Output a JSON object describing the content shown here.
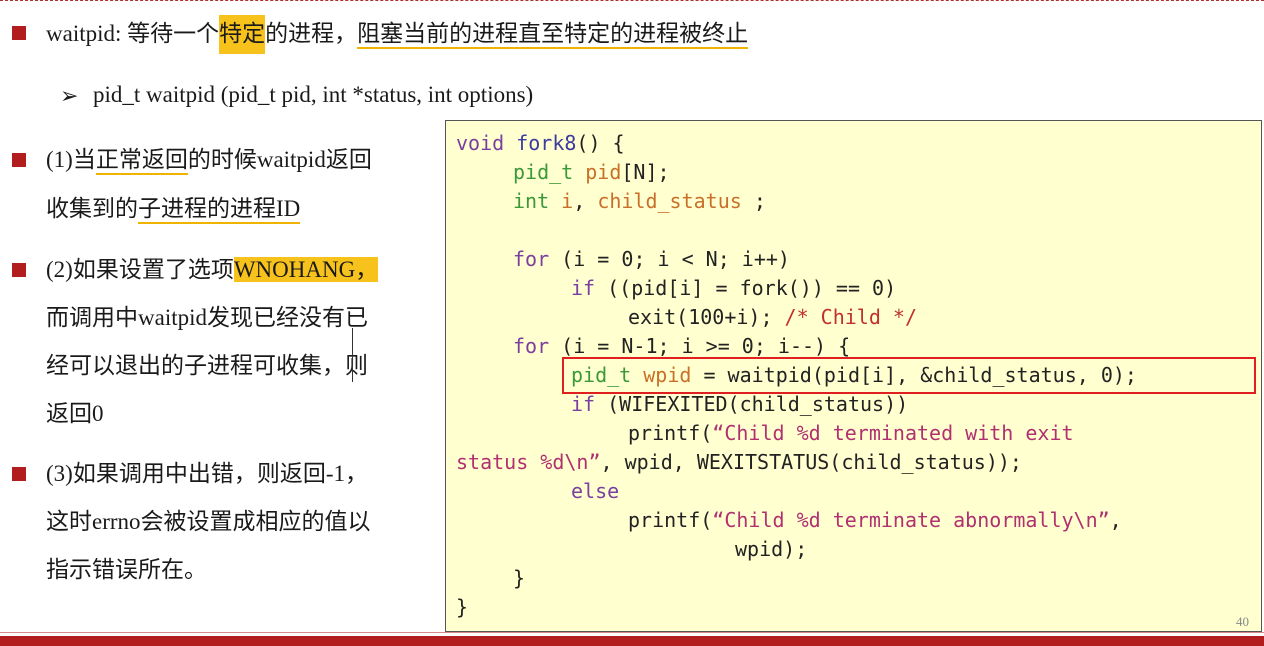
{
  "slide": {
    "header": {
      "prefix": "waitpid: 等待一个",
      "hl1": "特定",
      "mid": "的进程，",
      "ul1": "阻塞当前的进程直至特定的进程被终止"
    },
    "signature": {
      "arrow": "➢",
      "text": "pid_t waitpid (pid_t pid, int *status, int options)"
    },
    "points": [
      {
        "line1a": "(1)当",
        "line1b": "正常返回",
        "line1c": "的时候waitpid返回",
        "line2a": "收集到的",
        "line2b": "子进程的进程ID"
      },
      {
        "line1a": "(2)如果设置了选项",
        "line1b": "WNOHANG，",
        "line2": "而调用中waitpid发现已经没有已",
        "line3": "经可以退出的子进程可收集，则",
        "line4": "返回0"
      },
      {
        "line1": "(3)如果调用中出错，则返回-1，",
        "line2": "这时errno会被设置成相应的值以",
        "line3": "指示错误所在。"
      }
    ],
    "code": {
      "l1a": "void",
      "l1b": " fork8",
      "l1c": "() {",
      "l2a": "pid_t",
      "l2b": " pid",
      "l2c": "[N];",
      "l3a": "int",
      "l3b": " i",
      "l3c": ", ",
      "l3d": "child_status",
      "l3e": " ;",
      "l5a": "for",
      "l5b": " (i = 0; i < N; i++)",
      "l6a": "if",
      "l6b": " ((pid[i] = fork()) == 0)",
      "l7a": "exit(100+i); ",
      "l7b": "/* Child */",
      "l8a": "for",
      "l8b": " (i = N-1; i >= 0; i--) {",
      "l9a": "pid_t",
      "l9b": " wpid",
      "l9c": " = waitpid(pid[i], &child_status, 0);",
      "l10a": "if",
      "l10b": " (WIFEXITED(child_status))",
      "l11a": "printf(",
      "l11b": "“Child %d terminated with exit",
      "l12a": "status %d\\n”",
      "l12b": ", wpid, WEXITSTATUS(child_status));",
      "l13": "else",
      "l14a": "printf(",
      "l14b": "“Child %d terminate abnormally\\n”",
      "l14c": ",",
      "l15": "wpid);",
      "l16": "}",
      "l17": "}"
    },
    "page_number": "40"
  },
  "colors": {
    "accent_red": "#b21e1e",
    "highlight_yellow": "#f7c21b",
    "code_bg": "#ffffd0",
    "box_red": "#e02020"
  }
}
